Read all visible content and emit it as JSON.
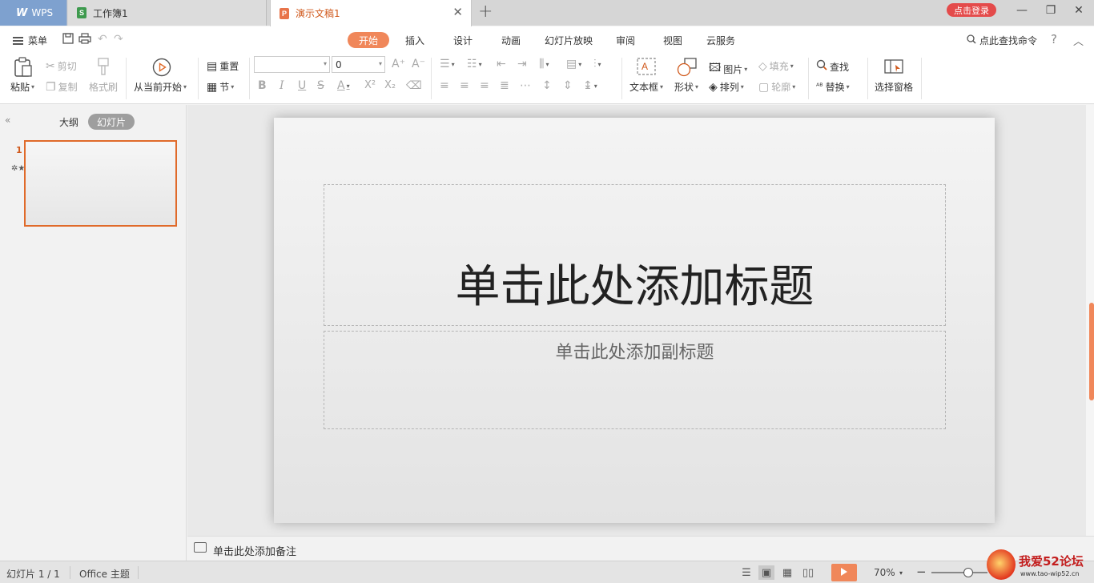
{
  "tabs": {
    "wps": "WPS",
    "workbook": "工作簿1",
    "presentation": "演示文稿1"
  },
  "titlebar": {
    "login": "点击登录"
  },
  "menu": {
    "main": "菜单",
    "ribbon_tabs": [
      "开始",
      "插入",
      "设计",
      "动画",
      "幻灯片放映",
      "审阅",
      "视图",
      "云服务"
    ],
    "active_tab": "开始",
    "search_command": "点此查找命令"
  },
  "toolbar": {
    "paste": "粘贴",
    "cut": "剪切",
    "copy": "复制",
    "format_painter": "格式刷",
    "from_current": "从当前开始",
    "reset": "重置",
    "section": "节",
    "font_name": "",
    "font_size": "0",
    "text_box": "文本框",
    "shape": "形状",
    "picture": "图片",
    "fill": "填充",
    "arrange": "排列",
    "outline": "轮廓",
    "find": "查找",
    "replace": "替换",
    "selection_pane": "选择窗格"
  },
  "left_panel": {
    "outline": "大纲",
    "slides": "幻灯片",
    "slide_number": "1"
  },
  "slide": {
    "title_placeholder": "单击此处添加标题",
    "subtitle_placeholder": "单击此处添加副标题"
  },
  "notes": {
    "placeholder": "单击此处添加备注"
  },
  "status": {
    "slide_counter": "幻灯片 1 / 1",
    "theme": "Office 主题",
    "zoom": "70%"
  },
  "watermark": {
    "text": "我爱52论坛",
    "url": "www.tao-wip52.cn"
  },
  "colors": {
    "accent": "#f0875a",
    "active_tab_text": "#d0591c",
    "login": "#e44b4b",
    "wps_tab": "#7ea1cf"
  }
}
